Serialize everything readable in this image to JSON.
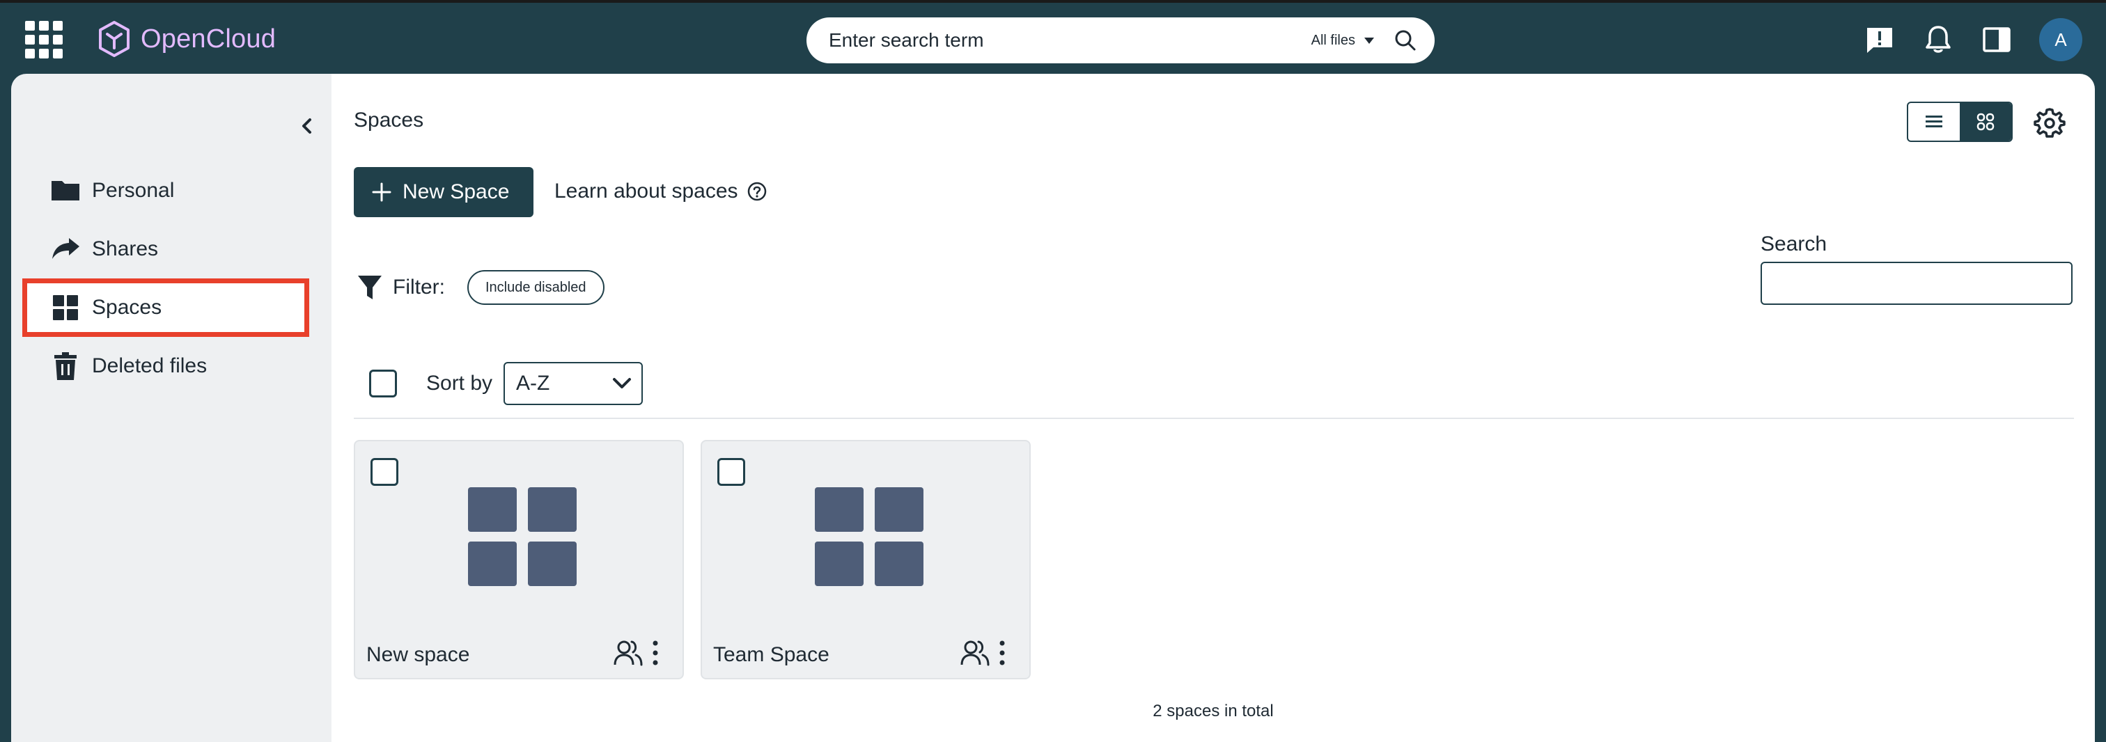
{
  "app": {
    "name": "OpenCloud",
    "brand_color": "#e2baff",
    "header_color": "#20404a"
  },
  "topbar": {
    "search_placeholder": "Enter search term",
    "search_scope": "All files",
    "user_initial": "A",
    "icons": [
      "app-switcher-icon",
      "feedback-icon",
      "bell-icon",
      "sidebar-panel-icon"
    ]
  },
  "sidebar": {
    "items": [
      {
        "label": "Personal",
        "icon": "folder-icon"
      },
      {
        "label": "Shares",
        "icon": "share-arrow-icon"
      },
      {
        "label": "Spaces",
        "icon": "spaces-grid-icon",
        "active": true
      },
      {
        "label": "Deleted files",
        "icon": "trash-icon"
      }
    ],
    "highlight_color": "#e8402b"
  },
  "main": {
    "breadcrumb": "Spaces",
    "new_space_label": "New Space",
    "learn_label": "Learn about spaces",
    "filter_label": "Filter:",
    "filter_chip": "Include disabled",
    "search_label": "Search",
    "sort_label": "Sort by",
    "sort_value": "A-Z",
    "view_mode": "tiles",
    "spaces": [
      {
        "name": "New space"
      },
      {
        "name": "Team Space"
      }
    ],
    "total_text": "2 spaces in total"
  }
}
